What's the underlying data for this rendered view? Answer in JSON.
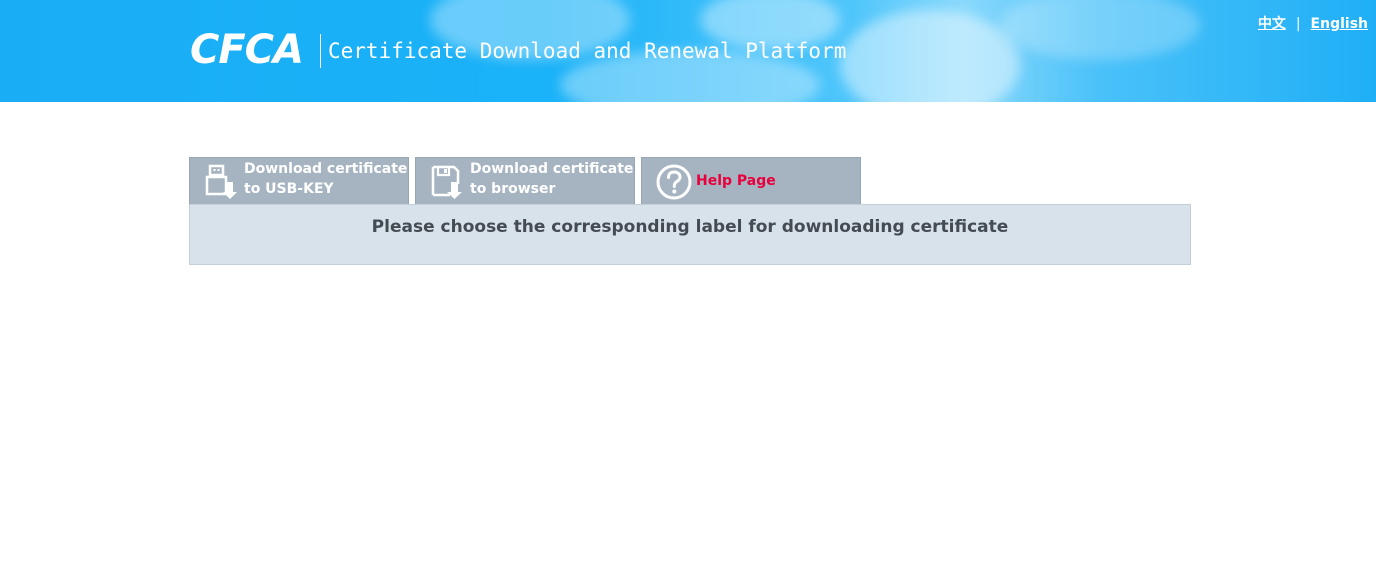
{
  "header": {
    "logo_text": "CFCA",
    "title": "Certificate Download and Renewal Platform",
    "lang_zh": "中文",
    "lang_sep": "|",
    "lang_en": "English"
  },
  "tabs": [
    {
      "line1": "Download certificate",
      "line2": "to USB-KEY",
      "icon": "usb-download-icon"
    },
    {
      "line1": "Download certificate",
      "line2": "to browser",
      "icon": "floppy-download-icon"
    },
    {
      "label": "Help Page",
      "icon": "question-circle-icon",
      "label_color": "#e8003d"
    }
  ],
  "panel": {
    "message": "Please choose the corresponding label for downloading certificate"
  },
  "colors": {
    "header_bg": "#19adf5",
    "tab_bg": "#a6b4c2",
    "panel_bg": "#d8e2eb",
    "help_text": "#e8003d"
  }
}
